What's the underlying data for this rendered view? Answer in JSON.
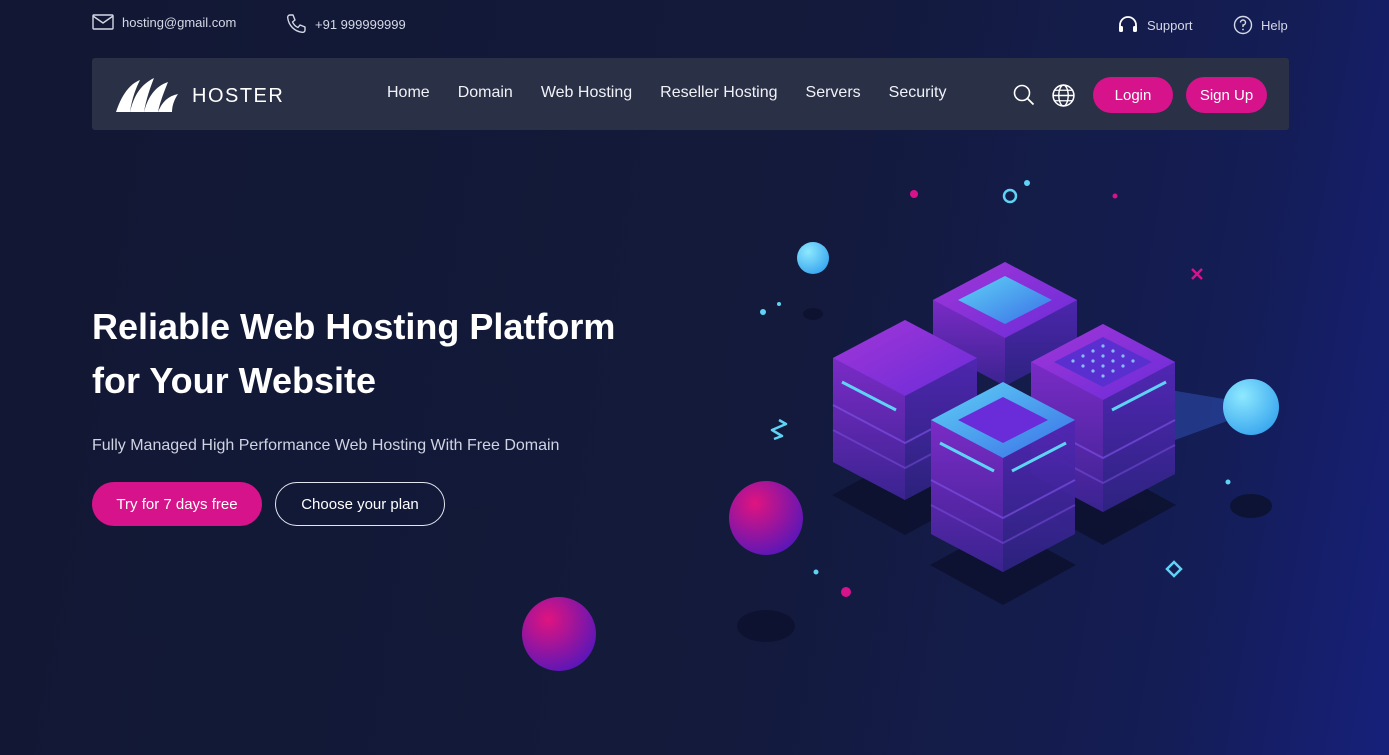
{
  "topbar": {
    "email": "hosting@gmail.com",
    "phone": "+91 999999999",
    "support": "Support",
    "help": "Help"
  },
  "brand": {
    "name": "HOSTER"
  },
  "nav": {
    "links": [
      "Home",
      "Domain",
      "Web Hosting",
      "Reseller Hosting",
      "Servers",
      "Security"
    ],
    "login": "Login",
    "signup": "Sign Up"
  },
  "hero": {
    "title_line1": "Reliable Web Hosting Platform",
    "title_line2": "for Your Website",
    "subtitle": "Fully Managed High Performance Web Hosting With Free Domain",
    "cta_primary": "Try for 7 days free",
    "cta_secondary": "Choose your plan"
  },
  "colors": {
    "accent": "#d6138b",
    "navbar": "#2a3045",
    "background": "#131a3b",
    "cyan": "#5fd3f5",
    "purple": "#8a2be2"
  },
  "icons": {
    "email": "mail-icon",
    "phone": "phone-icon",
    "support": "headset-icon",
    "help": "question-circle-icon",
    "search": "search-icon",
    "language": "globe-icon"
  }
}
